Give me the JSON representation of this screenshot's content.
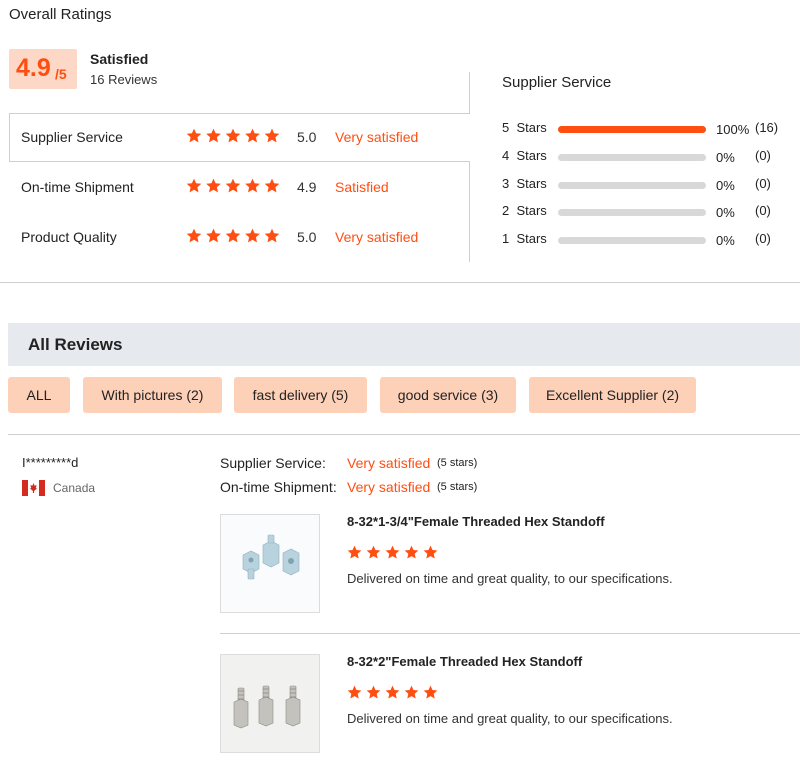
{
  "overall": {
    "title": "Overall Ratings",
    "score": "4.9",
    "score_of": "/5",
    "score_word": "Satisfied",
    "review_count": "16 Reviews",
    "rows": [
      {
        "label": "Supplier Service",
        "rating": 5,
        "num": "5.0",
        "word": "Very satisfied"
      },
      {
        "label": "On-time Shipment",
        "rating": 5,
        "num": "4.9",
        "word": "Satisfied"
      },
      {
        "label": "Product Quality",
        "rating": 5,
        "num": "5.0",
        "word": "Very satisfied"
      }
    ]
  },
  "distribution": {
    "title": "Supplier Service",
    "rows": [
      {
        "label": "5  Stars",
        "fraction": 1.0,
        "pct": "100%",
        "count": "(16)"
      },
      {
        "label": "4  Stars",
        "fraction": 0,
        "pct": "0%",
        "count": "(0)"
      },
      {
        "label": "3  Stars",
        "fraction": 0,
        "pct": "0%",
        "count": "(0)"
      },
      {
        "label": "2  Stars",
        "fraction": 0,
        "pct": "0%",
        "count": "(0)"
      },
      {
        "label": "1  Stars",
        "fraction": 0,
        "pct": "0%",
        "count": "(0)"
      }
    ]
  },
  "reviews": {
    "title": "All Reviews",
    "filters": [
      "ALL",
      "With pictures (2)",
      "fast delivery (5)",
      "good service (3)",
      "Excellent Supplier (2)"
    ],
    "reviewer": {
      "name": "I*********d",
      "country": "Canada",
      "flag_icon": "canada-flag-icon",
      "metrics": [
        {
          "label": "Supplier Service:",
          "value": "Very satisfied",
          "stars": "(5 stars)"
        },
        {
          "label": "On-time Shipment:",
          "value": "Very satisfied",
          "stars": "(5 stars)"
        }
      ],
      "products": [
        {
          "title": "8-32*1-3/4\"Female Threaded Hex Standoff",
          "rating": 5,
          "text": "Delivered on time and great quality, to our specifications."
        },
        {
          "title": "8-32*2\"Female Threaded Hex Standoff",
          "rating": 5,
          "text": "Delivered on time and great quality, to our specifications."
        }
      ]
    }
  },
  "colors": {
    "accent": "#ff4e12",
    "chip_bg": "#fdd0b8",
    "score_bg": "#fdd8c6",
    "band_bg": "#e6e9ee"
  }
}
